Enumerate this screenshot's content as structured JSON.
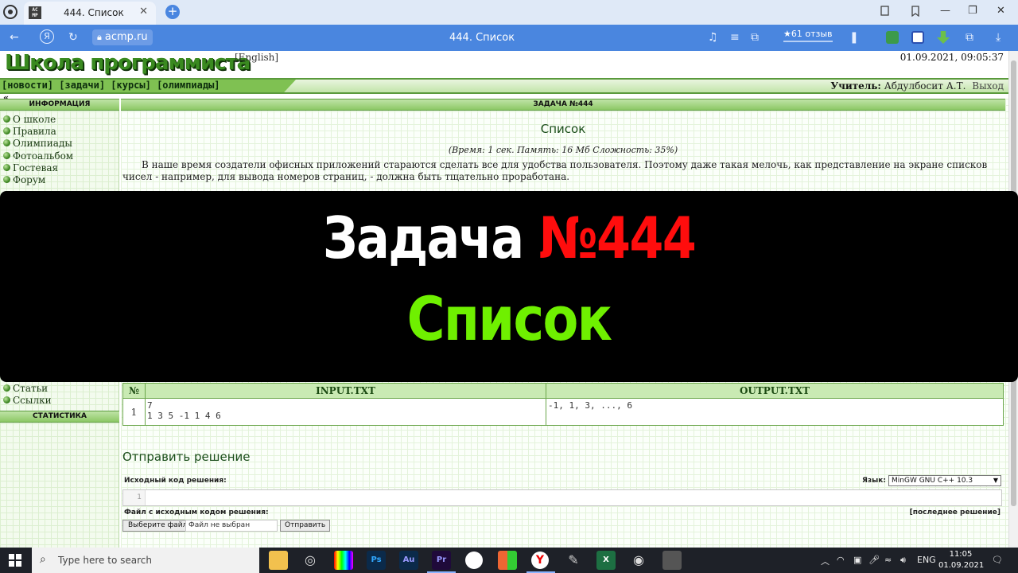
{
  "browser": {
    "tab_title": "444. Список",
    "tab_favicon_text": "AC MP",
    "tab_close": "✕",
    "new_tab": "+",
    "url": "acmp.ru",
    "page_title": "444. Список",
    "reviews": "★61 отзыв",
    "window_controls": [
      "—",
      "❐",
      "✕"
    ]
  },
  "site": {
    "logo": "Школа программиста",
    "english_link": "[English]",
    "datetime": "01.09.2021, 09:05:37",
    "menu": "[новости] [задачи] [курсы] [олимпиады]",
    "teacher_label": "Учитель:",
    "teacher_name": "Абдулбосит А.Т.",
    "logout": "Выход",
    "collapse": "«"
  },
  "sidebar": {
    "info_header": "ИНФОРМАЦИЯ",
    "items": [
      "О школе",
      "Правила",
      "Олимпиады",
      "Фотоальбом",
      "Гостевая",
      "Форум"
    ],
    "items_lower": [
      "Статьи",
      "Ссылки"
    ],
    "stats_header": "СТАТИСТИКА"
  },
  "task": {
    "header": "ЗАДАЧА №444",
    "title": "Список",
    "meta": "(Время: 1 сек. Память: 16 Мб Сложность: 35%)",
    "text": "В наше время создатели офисных приложений стараются сделать все для удобства пользователя. Поэтому даже такая мелочь, как представление на экране списков чисел - например, для вывода номеров страниц, - должна быть тщательно проработана."
  },
  "examples": {
    "headers": [
      "№",
      "INPUT.TXT",
      "OUTPUT.TXT"
    ],
    "rows": [
      {
        "num": "1",
        "input": "7\n1 3 5 -1 1 4 6",
        "output": "-1, 1, 3, ..., 6"
      }
    ]
  },
  "submit": {
    "title": "Отправить решение",
    "source_label": "Исходный код решения:",
    "lang_label": "Язык:",
    "lang_value": "MinGW GNU C++ 10.3",
    "line_number": "1",
    "file_label": "Файл с исходным кодом решения:",
    "last_solution": "[последнее решение]",
    "choose_file": "Выберите файл",
    "no_file": "Файл не выбран",
    "send": "Отправить"
  },
  "banner": {
    "word": "Задача",
    "number": "№444",
    "subtitle": "Список"
  },
  "taskbar": {
    "search_placeholder": "Type here to search",
    "apps": [
      "Ps",
      "Au",
      "Pr",
      "X"
    ],
    "lang": "ENG",
    "time": "11:05",
    "date": "01.09.2021"
  },
  "colors": {
    "browser_blue": "#4a86df",
    "site_green": "#7fc152",
    "banner_red": "#ff0d0d",
    "banner_green": "#6ff000"
  }
}
